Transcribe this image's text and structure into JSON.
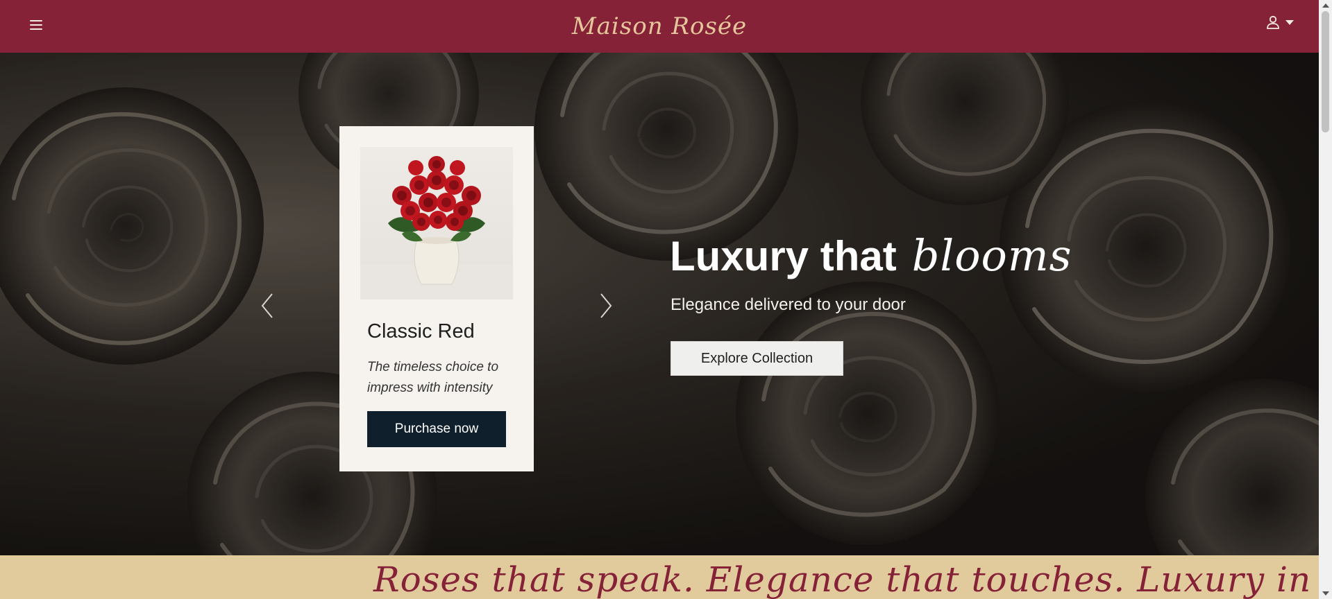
{
  "header": {
    "brand": "Maison Rosée",
    "menu_icon": "hamburger-menu-icon",
    "user_icon": "user-icon",
    "caret_icon": "caret-down-icon",
    "background_color": "#862238",
    "brand_color": "#e6c79c"
  },
  "hero": {
    "headline_main": "Luxury that",
    "headline_script": "blooms",
    "tagline": "Elegance delivered to your door",
    "cta_label": "Explore Collection",
    "prev_icon": "chevron-left-icon",
    "next_icon": "chevron-right-icon"
  },
  "product_card": {
    "title": "Classic Red",
    "description": "The timeless choice to impress with intensity",
    "button_label": "Purchase now",
    "button_color": "#0f1f2c"
  },
  "strip": {
    "text": "Roses that speak. Elegance that touches. Luxury in every detail.",
    "background_color": "#e1cb9d"
  }
}
